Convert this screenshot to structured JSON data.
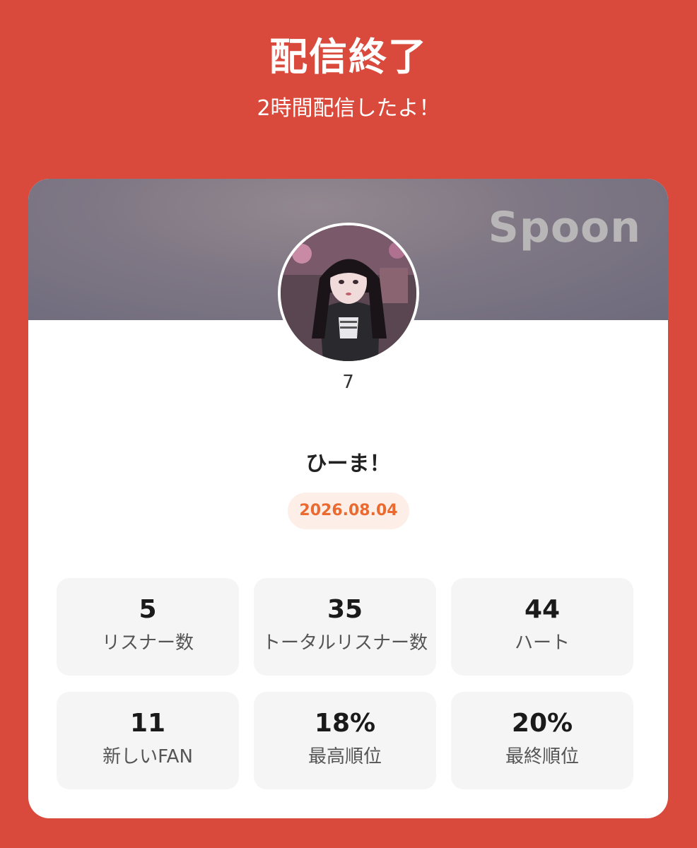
{
  "header": {
    "title": "配信終了",
    "subtitle": "2時間配信したよ！"
  },
  "card": {
    "logo_text": "Spoon",
    "user_name": "7",
    "stream_title": "ひーま！",
    "date": "2026.08.04",
    "colors": {
      "background": "#d94a3c",
      "date_text": "#ea6a2f",
      "date_badge": "#fdeee8"
    }
  },
  "stats": [
    {
      "value": "5",
      "label": "リスナー数"
    },
    {
      "value": "35",
      "label": "トータルリスナー数"
    },
    {
      "value": "44",
      "label": "ハート"
    },
    {
      "value": "11",
      "label": "新しいFAN"
    },
    {
      "value": "18%",
      "label": "最高順位"
    },
    {
      "value": "20%",
      "label": "最終順位"
    }
  ]
}
